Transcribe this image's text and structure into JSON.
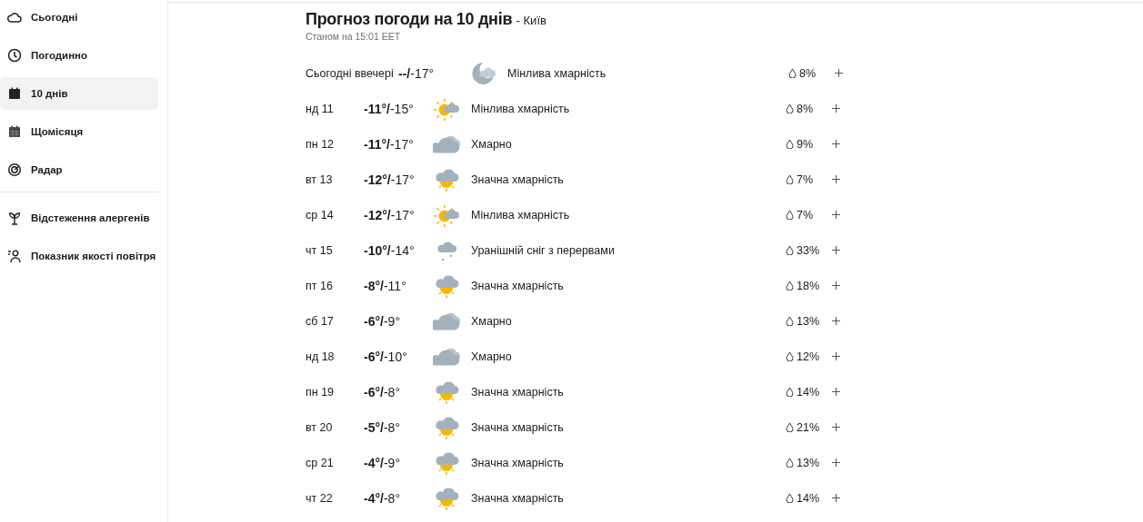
{
  "sidebar": {
    "items": [
      {
        "label": "Сьогодні",
        "kind": "cloud",
        "selected": false
      },
      {
        "label": "Погодинно",
        "kind": "clock",
        "selected": false
      },
      {
        "label": "10 днів",
        "kind": "calendar",
        "selected": true
      },
      {
        "label": "Щомісяця",
        "kind": "month",
        "selected": false
      },
      {
        "label": "Радар",
        "kind": "radar",
        "selected": false
      }
    ],
    "extra_items": [
      {
        "label": "Відстеження алергенів",
        "kind": "sprout",
        "selected": false
      },
      {
        "label": "Показник якості повітря",
        "kind": "person",
        "selected": false
      }
    ]
  },
  "header": {
    "title": "Прогноз погоди на 10 днів",
    "location": "- Київ",
    "updated": "Станом на 15:01 EET"
  },
  "tonight": {
    "label": "Сьогодні ввечері",
    "temps": "--/",
    "low": "-17°",
    "kind": "partly_cloudy_night",
    "condition": "Мінлива хмарність",
    "precip": "8%"
  },
  "days": [
    {
      "date": "нд 11",
      "high": "-11°/",
      "low": "-15°",
      "kind": "partly_cloudy_day",
      "condition": "Мінлива хмарність",
      "precip": "8%"
    },
    {
      "date": "пн 12",
      "high": "-11°/",
      "low": "-17°",
      "kind": "cloudy",
      "condition": "Хмарно",
      "precip": "9%"
    },
    {
      "date": "вт 13",
      "high": "-12°/",
      "low": "-17°",
      "kind": "mostly_cloudy_day",
      "condition": "Значна хмарність",
      "precip": "7%"
    },
    {
      "date": "ср 14",
      "high": "-12°/",
      "low": "-17°",
      "kind": "partly_cloudy_day",
      "condition": "Мінлива хмарність",
      "precip": "7%"
    },
    {
      "date": "чт 15",
      "high": "-10°/",
      "low": "-14°",
      "kind": "snow",
      "condition": "Уранішній сніг з перервами",
      "precip": "33%"
    },
    {
      "date": "пт 16",
      "high": "-8°/",
      "low": "-11°",
      "kind": "mostly_cloudy_day",
      "condition": "Значна хмарність",
      "precip": "18%"
    },
    {
      "date": "сб 17",
      "high": "-6°/",
      "low": "-9°",
      "kind": "cloudy",
      "condition": "Хмарно",
      "precip": "13%"
    },
    {
      "date": "нд 18",
      "high": "-6°/",
      "low": "-10°",
      "kind": "cloudy",
      "condition": "Хмарно",
      "precip": "12%"
    },
    {
      "date": "пн 19",
      "high": "-6°/",
      "low": "-8°",
      "kind": "mostly_cloudy_day",
      "condition": "Значна хмарність",
      "precip": "14%"
    },
    {
      "date": "вт 20",
      "high": "-5°/",
      "low": "-8°",
      "kind": "mostly_cloudy_day",
      "condition": "Значна хмарність",
      "precip": "21%"
    },
    {
      "date": "ср 21",
      "high": "-4°/",
      "low": "-9°",
      "kind": "mostly_cloudy_day",
      "condition": "Значна хмарність",
      "precip": "13%"
    },
    {
      "date": "чт 22",
      "high": "-4°/",
      "low": "-8°",
      "kind": "mostly_cloudy_day",
      "condition": "Значна хмарність",
      "precip": "14%"
    }
  ]
}
